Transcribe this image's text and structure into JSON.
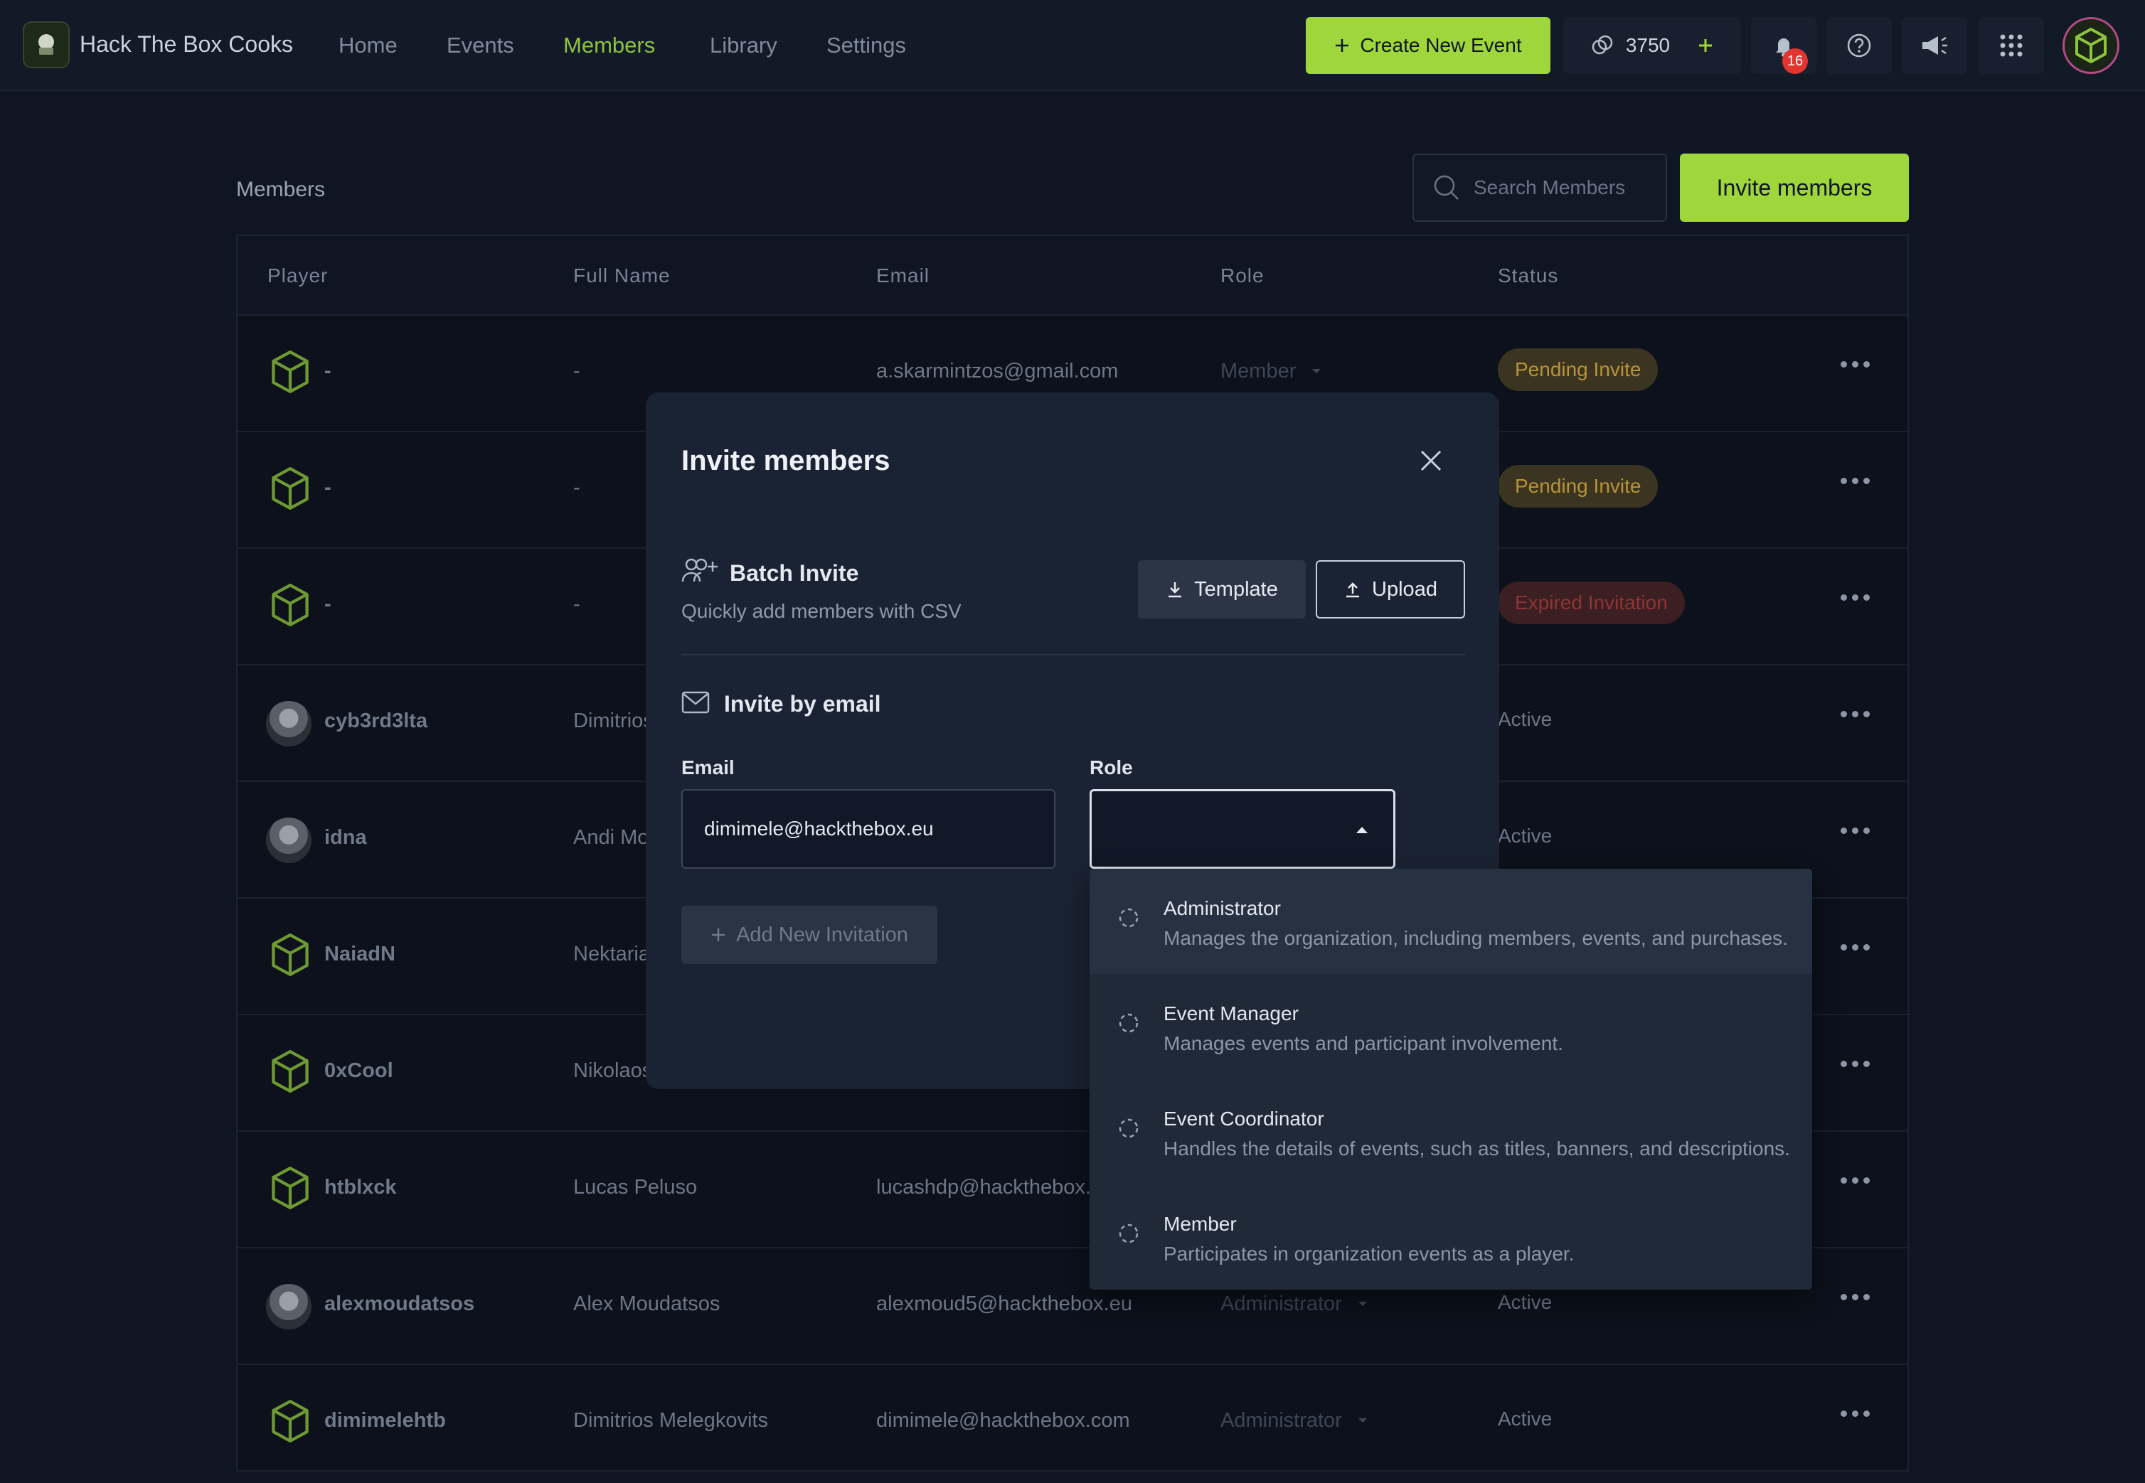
{
  "nav": {
    "org_name": "Hack The Box Cooks",
    "links": [
      "Home",
      "Events",
      "Members",
      "Library",
      "Settings"
    ],
    "active": "Members",
    "create_event_label": "Create New Event",
    "credits": "3750",
    "notification_count": "16"
  },
  "page": {
    "title": "Members",
    "search_placeholder": "Search Members",
    "invite_button": "Invite members"
  },
  "table": {
    "headers": [
      "Player",
      "Full Name",
      "Email",
      "Role",
      "Status"
    ],
    "rows": [
      {
        "player": "-",
        "full_name": "-",
        "email": "a.skarmintzos@gmail.com",
        "role": "Member",
        "status": "Pending Invite",
        "avatar": "cube"
      },
      {
        "player": "-",
        "full_name": "-",
        "email": "",
        "role": "",
        "status": "Pending Invite",
        "avatar": "cube"
      },
      {
        "player": "-",
        "full_name": "-",
        "email": "",
        "role": "",
        "status": "Expired Invitation",
        "avatar": "cube"
      },
      {
        "player": "cyb3rd3lta",
        "full_name": "Dimitrios",
        "email": "",
        "role": "",
        "status": "Active",
        "avatar": "photo"
      },
      {
        "player": "idna",
        "full_name": "Andi Mo",
        "email": "",
        "role": "",
        "status": "Active",
        "avatar": "photo"
      },
      {
        "player": "NaiadN",
        "full_name": "Nektaria",
        "email": "",
        "role": "",
        "status": "",
        "avatar": "cube"
      },
      {
        "player": "0xCool",
        "full_name": "Nikolaos",
        "email": "",
        "role": "",
        "status": "",
        "avatar": "cube"
      },
      {
        "player": "htblxck",
        "full_name": "Lucas Peluso",
        "email": "lucashdp@hackthebox.e",
        "role": "",
        "status": "",
        "avatar": "cube"
      },
      {
        "player": "alexmoudatsos",
        "full_name": "Alex Moudatsos",
        "email": "alexmoud5@hackthebox.eu",
        "role": "Administrator",
        "status": "Active",
        "avatar": "photo"
      },
      {
        "player": "dimimelehtb",
        "full_name": "Dimitrios Melegkovits",
        "email": "dimimele@hackthebox.com",
        "role": "Administrator",
        "status": "Active",
        "avatar": "cube"
      }
    ]
  },
  "modal": {
    "title": "Invite members",
    "batch_title": "Batch Invite",
    "batch_subtitle": "Quickly add members with CSV",
    "template_label": "Template",
    "upload_label": "Upload",
    "email_section_title": "Invite by email",
    "email_label": "Email",
    "email_value": "dimimele@hackthebox.eu",
    "role_label": "Role",
    "add_invitation_label": "Add New Invitation"
  },
  "role_options": [
    {
      "name": "Administrator",
      "description": "Manages the organization, including members, events, and purchases."
    },
    {
      "name": "Event Manager",
      "description": "Manages events and participant involvement."
    },
    {
      "name": "Event Coordinator",
      "description": "Handles the details of events, such as titles, banners, and descriptions."
    },
    {
      "name": "Member",
      "description": "Participates in organization events as a player."
    }
  ],
  "colors": {
    "accent": "#9fd63c",
    "background": "#0f1522",
    "pending": "#b89438",
    "expired": "#8f3533",
    "notification": "#e3342f"
  }
}
